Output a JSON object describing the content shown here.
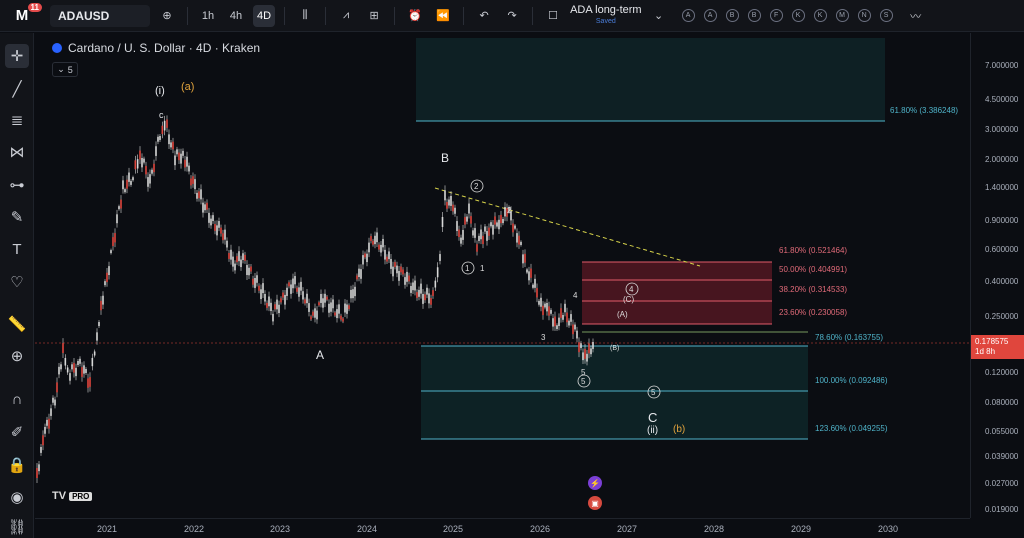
{
  "topbar": {
    "logo": "M",
    "notification_count": "11",
    "symbol": "ADAUSD",
    "timeframes": [
      "1h",
      "4h",
      "4D"
    ],
    "active_timeframe": "4D",
    "layout_name": "ADA long-term",
    "layout_status": "Saved",
    "alert_circles": [
      "A",
      "A",
      "B",
      "B",
      "F",
      "K",
      "K",
      "M",
      "N",
      "S"
    ]
  },
  "chart": {
    "title": "Cardano / U. S. Dollar · 4D · Kraken",
    "indicator_count": "5",
    "brand": "TV",
    "brand_badge": "PRO",
    "colors": {
      "candles": "#d8d8d8",
      "accent_red": "#e0463d",
      "fib_box_red": "#7a1e2a",
      "fib_box_teal": "#0f2a2c",
      "fib_line": "#4fb3c9",
      "trend_line": "#d6d24a"
    },
    "wave_labels": {
      "i": "(i)",
      "a_orange": "(a)",
      "c_small": "c",
      "A": "A",
      "B": "B",
      "C": "C",
      "ii": "(ii)",
      "b_orange": "(b)",
      "w2": "2",
      "w2b": "2",
      "w1": "1",
      "w1b": "1",
      "w3": "3",
      "w4": "4",
      "w4c": "4",
      "w5": "5",
      "w5c": "5",
      "w5b": "5",
      "A_paren": "(A)",
      "B_paren": "(B)",
      "C_paren": "(C)"
    },
    "fib_levels": [
      {
        "label": "61.80% (3.386248)"
      },
      {
        "label": "61.80% (0.521464)"
      },
      {
        "label": "50.00% (0.404991)"
      },
      {
        "label": "38.20% (0.314533)"
      },
      {
        "label": "23.60% (0.230058)"
      },
      {
        "label": "78.60% (0.163755)"
      },
      {
        "label": "100.00% (0.092486)"
      },
      {
        "label": "123.60% (0.049255)"
      }
    ]
  },
  "price_axis": {
    "ticks": [
      "7.000000",
      "4.500000",
      "3.000000",
      "2.000000",
      "1.400000",
      "0.900000",
      "0.600000",
      "0.400000",
      "0.250000",
      "0.120000",
      "0.080000",
      "0.055000",
      "0.039000",
      "0.027000",
      "0.019000"
    ],
    "current_price": "0.178575",
    "countdown": "1d 8h"
  },
  "time_axis": {
    "ticks": [
      "2021",
      "2022",
      "2023",
      "2024",
      "2025",
      "2026",
      "2027",
      "2028",
      "2029",
      "2030"
    ]
  }
}
